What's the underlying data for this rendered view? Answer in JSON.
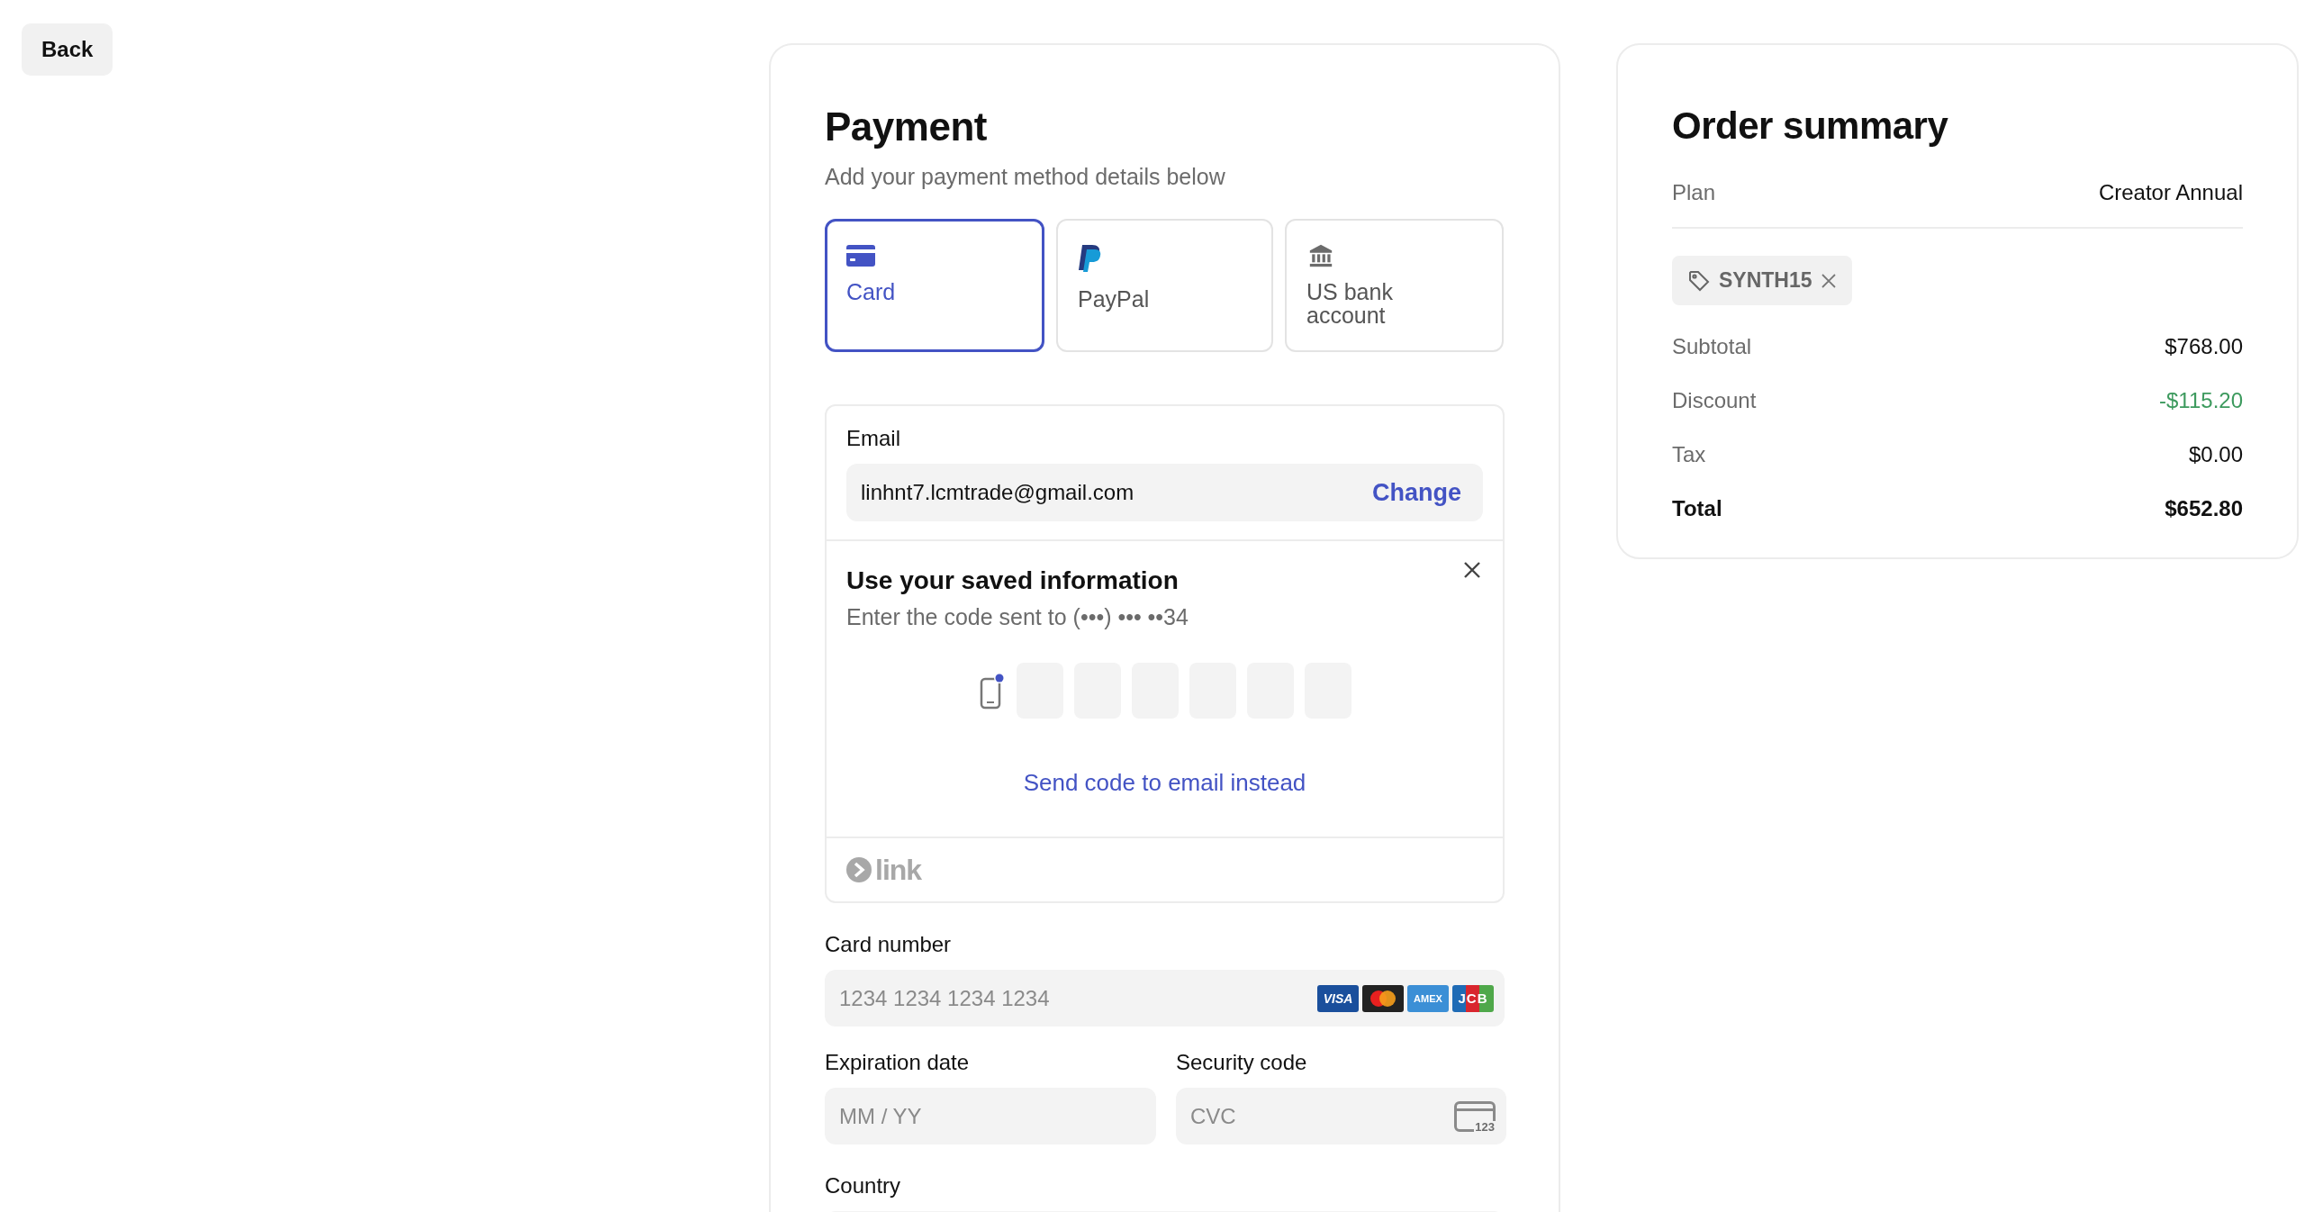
{
  "back_button": "Back",
  "payment": {
    "title": "Payment",
    "subtitle": "Add your payment method details below",
    "methods": [
      {
        "label": "Card",
        "kind": "card",
        "selected": true
      },
      {
        "label": "PayPal",
        "kind": "paypal",
        "selected": false
      },
      {
        "label": "US bank account",
        "kind": "bank",
        "selected": false
      }
    ],
    "link": {
      "email_label": "Email",
      "email": "linhnt7.lcmtrade@gmail.com",
      "change": "Change",
      "saved_title": "Use your saved information",
      "saved_subtitle": "Enter the code sent to (•••) ••• ••34",
      "send_code": "Send code to email instead",
      "brand": "link"
    },
    "card_number": {
      "label": "Card number",
      "placeholder": "1234 1234 1234 1234",
      "brands": [
        {
          "kind": "visa",
          "label": "VISA"
        },
        {
          "kind": "mastercard"
        },
        {
          "kind": "amex",
          "label": "AMEX"
        },
        {
          "kind": "jcb",
          "label": "JCB"
        }
      ]
    },
    "expiration": {
      "label": "Expiration date",
      "placeholder": "MM / YY"
    },
    "security": {
      "label": "Security code",
      "placeholder": "CVC",
      "icon_text": "123"
    },
    "country": {
      "label": "Country"
    }
  },
  "summary": {
    "title": "Order summary",
    "plan_label": "Plan",
    "plan": "Creator Annual",
    "coupon": "SYNTH15",
    "rows": [
      {
        "label": "Subtotal",
        "value": "$768.00",
        "kind": "normal"
      },
      {
        "label": "Discount",
        "value": "-$115.20",
        "kind": "discount"
      },
      {
        "label": "Tax",
        "value": "$0.00",
        "kind": "normal"
      },
      {
        "label": "Total",
        "value": "$652.80",
        "kind": "total"
      }
    ]
  }
}
